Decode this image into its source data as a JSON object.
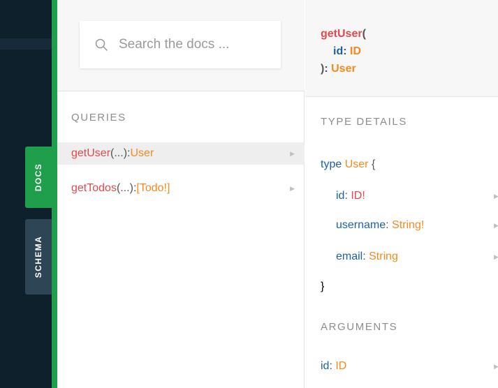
{
  "sidebar": {
    "tabs": [
      {
        "label": "DOCS",
        "active": true
      },
      {
        "label": "SCHEMA",
        "active": false
      }
    ]
  },
  "colors": {
    "accent_green": "#1f9f4b",
    "function_name": "#e5484d",
    "type_name": "#f58a1f",
    "field_name": "#1f61a0"
  },
  "search": {
    "placeholder": "Search the docs ...",
    "icon": "search-icon"
  },
  "queries": {
    "title": "QUERIES",
    "items": [
      {
        "name": "getUser",
        "args": "(...)",
        "sep": ": ",
        "type": "User",
        "active": true
      },
      {
        "name": "getTodos",
        "args": "(...)",
        "sep": ": ",
        "type": "[Todo!]",
        "active": false
      }
    ]
  },
  "detail": {
    "signature": {
      "name": "getUser",
      "open": "(",
      "arg_name": "id",
      "arg_sep": ": ",
      "arg_type": "ID",
      "close": "): ",
      "return_type": "User"
    },
    "type_details_title": "TYPE DETAILS",
    "type_decl": {
      "keyword": "type",
      "name": "User",
      "open": "{",
      "close": "}"
    },
    "fields": [
      {
        "name": "id",
        "sep": ": ",
        "type": "ID!"
      },
      {
        "name": "username",
        "sep": ": ",
        "type": "String!"
      },
      {
        "name": "email",
        "sep": ": ",
        "type": "String"
      }
    ],
    "arguments_title": "ARGUMENTS",
    "arguments": [
      {
        "name": "id",
        "sep": ": ",
        "type": "ID"
      }
    ]
  }
}
